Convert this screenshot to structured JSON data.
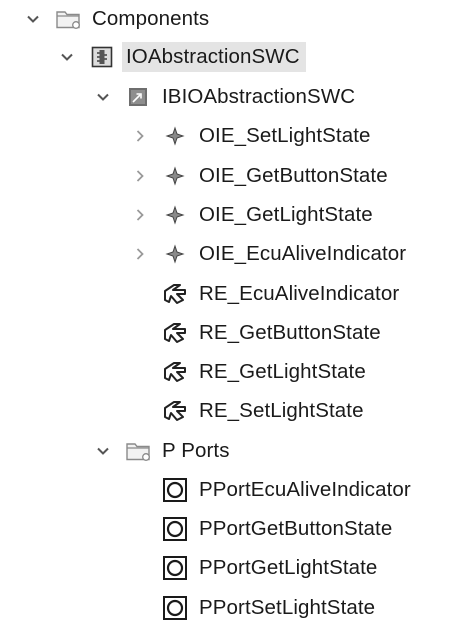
{
  "tree": {
    "root": {
      "label": "Components",
      "icon": "folder-icon",
      "expanded": true,
      "children": {
        "swc": {
          "label": "IOAbstractionSWC",
          "icon": "software-component-icon",
          "expanded": true,
          "selected": true,
          "behavior": {
            "label": "IBIOAbstractionSWC",
            "icon": "internal-behavior-icon",
            "expanded": true,
            "events": [
              {
                "label": "OIE_SetLightState",
                "icon": "event-icon",
                "expanded": false
              },
              {
                "label": "OIE_GetButtonState",
                "icon": "event-icon",
                "expanded": false
              },
              {
                "label": "OIE_GetLightState",
                "icon": "event-icon",
                "expanded": false
              },
              {
                "label": "OIE_EcuAliveIndicator",
                "icon": "event-icon",
                "expanded": false
              }
            ],
            "runnables": [
              {
                "label": "RE_EcuAliveIndicator",
                "icon": "runnable-icon"
              },
              {
                "label": "RE_GetButtonState",
                "icon": "runnable-icon"
              },
              {
                "label": "RE_GetLightState",
                "icon": "runnable-icon"
              },
              {
                "label": "RE_SetLightState",
                "icon": "runnable-icon"
              }
            ]
          },
          "pports": {
            "label": "P Ports",
            "icon": "folder-icon",
            "expanded": true,
            "items": [
              {
                "label": "PPortEcuAliveIndicator",
                "icon": "provided-port-icon"
              },
              {
                "label": "PPortGetButtonState",
                "icon": "provided-port-icon"
              },
              {
                "label": "PPortGetLightState",
                "icon": "provided-port-icon"
              },
              {
                "label": "PPortSetLightState",
                "icon": "provided-port-icon"
              }
            ]
          }
        }
      }
    }
  },
  "colors": {
    "text": "#1a1a1a",
    "selection": "#e4e4e4",
    "chevron": "#555555",
    "chevron_collapsed": "#999999"
  }
}
